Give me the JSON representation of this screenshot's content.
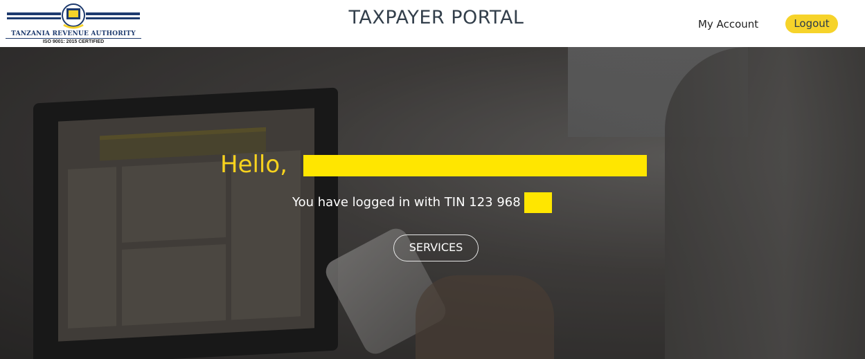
{
  "header": {
    "logo": {
      "org_name": "TANZANIA REVENUE AUTHORITY",
      "certification": "ISO 9001: 2015 CERTIFIED",
      "emblem_icon": "tra-emblem-icon"
    },
    "title": "TAXPAYER PORTAL",
    "my_account_label": "My Account",
    "logout_label": "Logout"
  },
  "hero": {
    "greeting": "Hello,",
    "tin_text": "You have logged in with TIN 123      968",
    "services_label": "SERVICES"
  },
  "colors": {
    "accent_yellow": "#f6d32a",
    "greeting_yellow": "#f7d21e",
    "redaction_yellow": "#ffe600",
    "title_color": "#333f4b"
  }
}
